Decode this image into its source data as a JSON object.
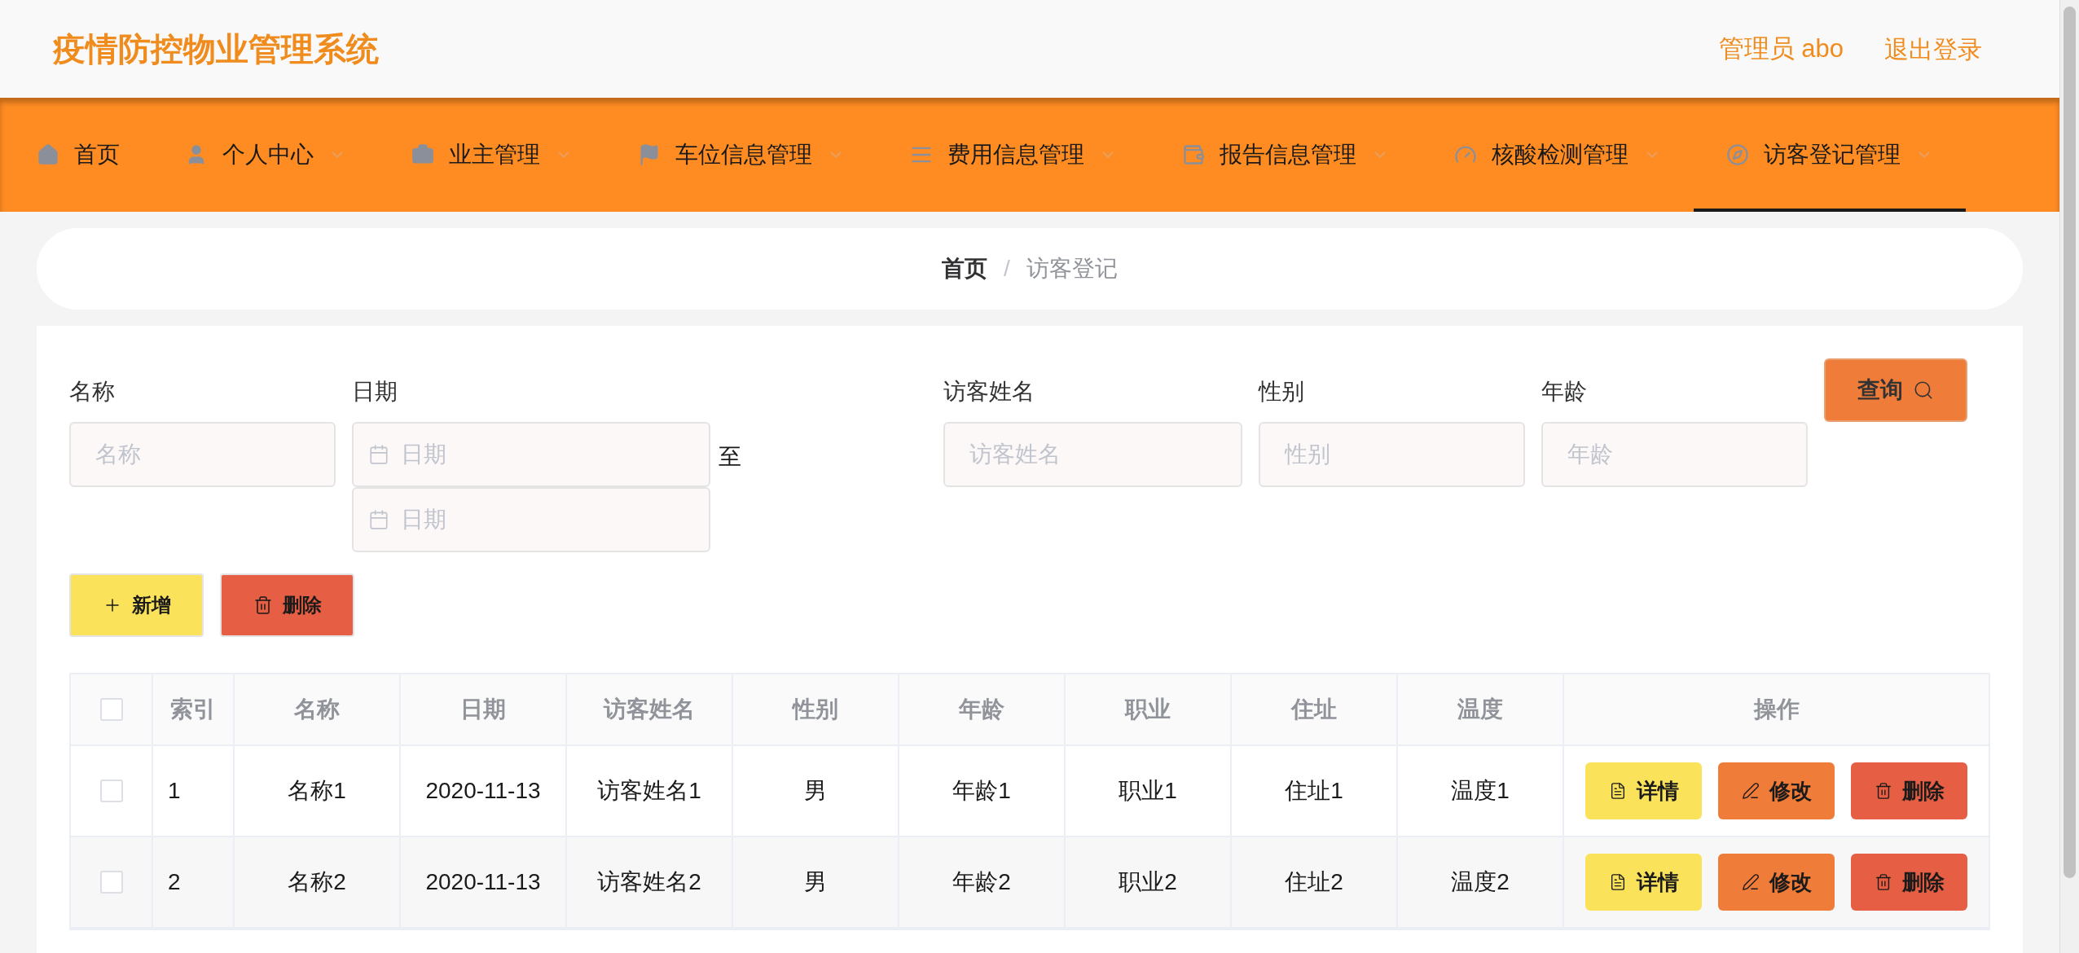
{
  "header": {
    "title": "疫情防控物业管理系统",
    "user_label": "管理员 abo",
    "logout": "退出登录"
  },
  "nav": {
    "items": [
      {
        "label": "首页",
        "dropdown": false,
        "selected": false
      },
      {
        "label": "个人中心",
        "dropdown": true,
        "selected": false
      },
      {
        "label": "业主管理",
        "dropdown": true,
        "selected": false
      },
      {
        "label": "车位信息管理",
        "dropdown": true,
        "selected": false
      },
      {
        "label": "费用信息管理",
        "dropdown": true,
        "selected": false
      },
      {
        "label": "报告信息管理",
        "dropdown": true,
        "selected": false
      },
      {
        "label": "核酸检测管理",
        "dropdown": true,
        "selected": false
      },
      {
        "label": "访客登记管理",
        "dropdown": true,
        "selected": true
      }
    ]
  },
  "breadcrumb": {
    "items": [
      "首页",
      "访客登记"
    ],
    "separator": "/"
  },
  "filters": [
    {
      "kind": "text",
      "label": "名称",
      "placeholder": "名称"
    },
    {
      "kind": "date_range",
      "label": "日期",
      "placeholder": "日期",
      "end_placeholder": "日期",
      "separator": "至"
    },
    {
      "kind": "text",
      "label": "访客姓名",
      "placeholder": "访客姓名"
    },
    {
      "kind": "text",
      "label": "性别",
      "placeholder": "性别"
    },
    {
      "kind": "text",
      "label": "年龄",
      "placeholder": "年龄"
    }
  ],
  "search_button": "查询",
  "toolbar": [
    {
      "kind": "add",
      "label": "新增"
    },
    {
      "kind": "delete",
      "label": "删除"
    }
  ],
  "table": {
    "select_all_checked": false,
    "columns": [
      "索引",
      "名称",
      "日期",
      "访客姓名",
      "性别",
      "年龄",
      "职业",
      "住址",
      "温度",
      "操作"
    ],
    "rows": [
      {
        "checked": false,
        "cells": [
          "1",
          "名称1",
          "2020-11-13",
          "访客姓名1",
          "男",
          "年龄1",
          "职业1",
          "住址1",
          "温度1"
        ],
        "actions": [
          {
            "kind": "detail",
            "label": "详情"
          },
          {
            "kind": "edit",
            "label": "修改"
          },
          {
            "kind": "delete",
            "label": "删除"
          }
        ]
      },
      {
        "checked": false,
        "cells": [
          "2",
          "名称2",
          "2020-11-13",
          "访客姓名2",
          "男",
          "年龄2",
          "职业2",
          "住址2",
          "温度2"
        ],
        "actions": [
          {
            "kind": "detail",
            "label": "详情"
          },
          {
            "kind": "edit",
            "label": "修改"
          },
          {
            "kind": "delete",
            "label": "删除"
          }
        ]
      }
    ]
  }
}
